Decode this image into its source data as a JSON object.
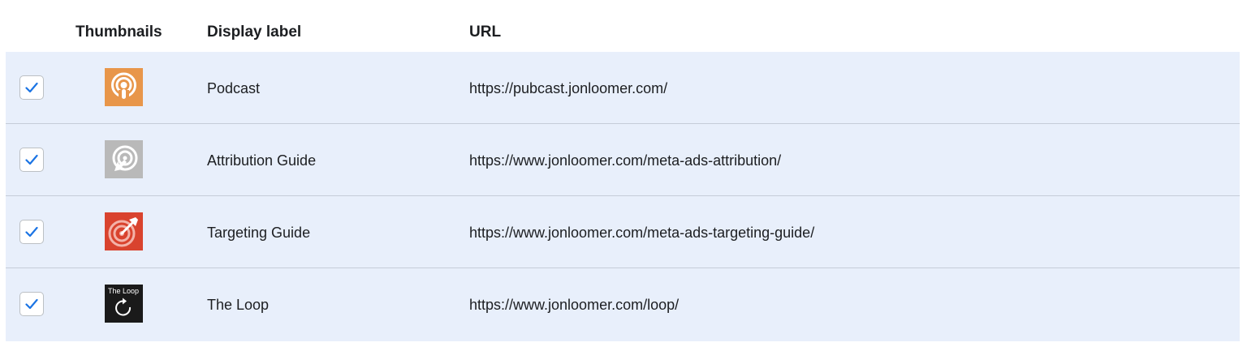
{
  "header": {
    "thumbnails": "Thumbnails",
    "display_label": "Display label",
    "url": "URL"
  },
  "rows": [
    {
      "label": "Podcast",
      "url": "https://pubcast.jonloomer.com/",
      "checked": true,
      "thumbnail": "podcast-icon",
      "thumb_color": "#e8964a"
    },
    {
      "label": "Attribution Guide",
      "url": "https://www.jonloomer.com/meta-ads-attribution/",
      "checked": true,
      "thumbnail": "target-cursor-icon",
      "thumb_color": "#b9b9b9"
    },
    {
      "label": "Targeting Guide",
      "url": "https://www.jonloomer.com/meta-ads-targeting-guide/",
      "checked": true,
      "thumbnail": "target-dart-icon",
      "thumb_color": "#d9432e"
    },
    {
      "label": "The Loop",
      "url": "https://www.jonloomer.com/loop/",
      "checked": true,
      "thumbnail": "loop-logo",
      "thumb_text": "The Loop",
      "thumb_color": "#1a1a1a"
    }
  ],
  "colors": {
    "row_background": "#e8effb",
    "check_color": "#1b74e4"
  }
}
